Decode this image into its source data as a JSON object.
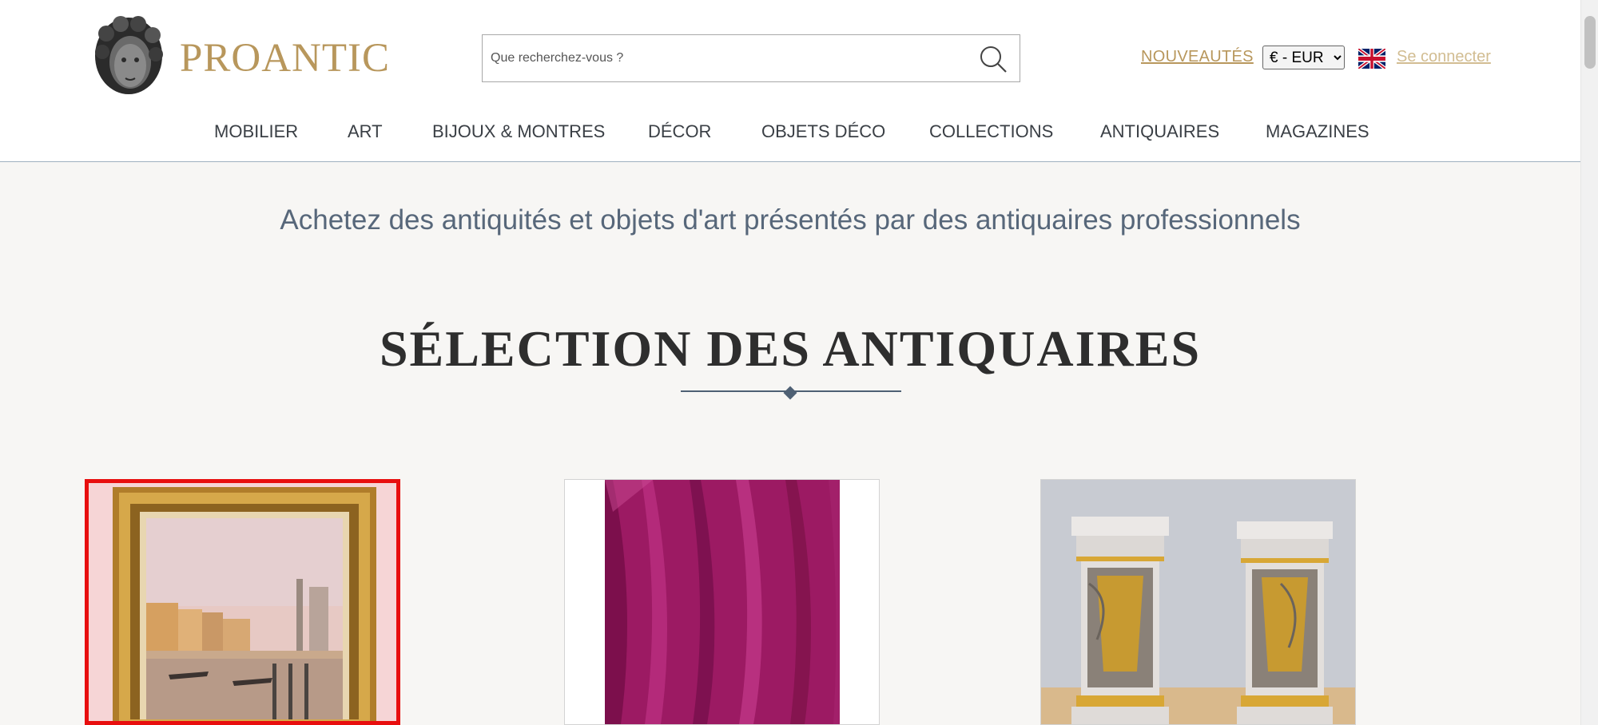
{
  "header": {
    "logo_text": "PROANTIC",
    "search_placeholder": "Que recherchez-vous ?",
    "nouveautes": "NOUVEAUTÉS",
    "currency": {
      "selected": "€ - EUR",
      "options": [
        "€ - EUR"
      ]
    },
    "language_flag": "uk-flag-icon",
    "login": "Se connecter",
    "colors": {
      "brand_gold": "#b8975c",
      "login_gold": "#d2bd92",
      "nav_text": "#3a3f45"
    }
  },
  "nav": {
    "items": [
      {
        "label": "MOBILIER"
      },
      {
        "label": "ART"
      },
      {
        "label": "BIJOUX & MONTRES"
      },
      {
        "label": "DÉCOR"
      },
      {
        "label": "OBJETS DÉCO"
      },
      {
        "label": "COLLECTIONS"
      },
      {
        "label": "ANTIQUAIRES"
      },
      {
        "label": "MAGAZINES"
      }
    ]
  },
  "main": {
    "tagline": "Achetez des antiquités et objets d'art présentés par des antiquaires professionnels",
    "section_title": "SÉLECTION DES ANTIQUAIRES",
    "products": [
      {
        "image": "venice-painting-gilt-frame",
        "selected": true
      },
      {
        "image": "magenta-velvet-fabric",
        "selected": false
      },
      {
        "image": "pair-marble-pedestals",
        "selected": false
      }
    ]
  }
}
